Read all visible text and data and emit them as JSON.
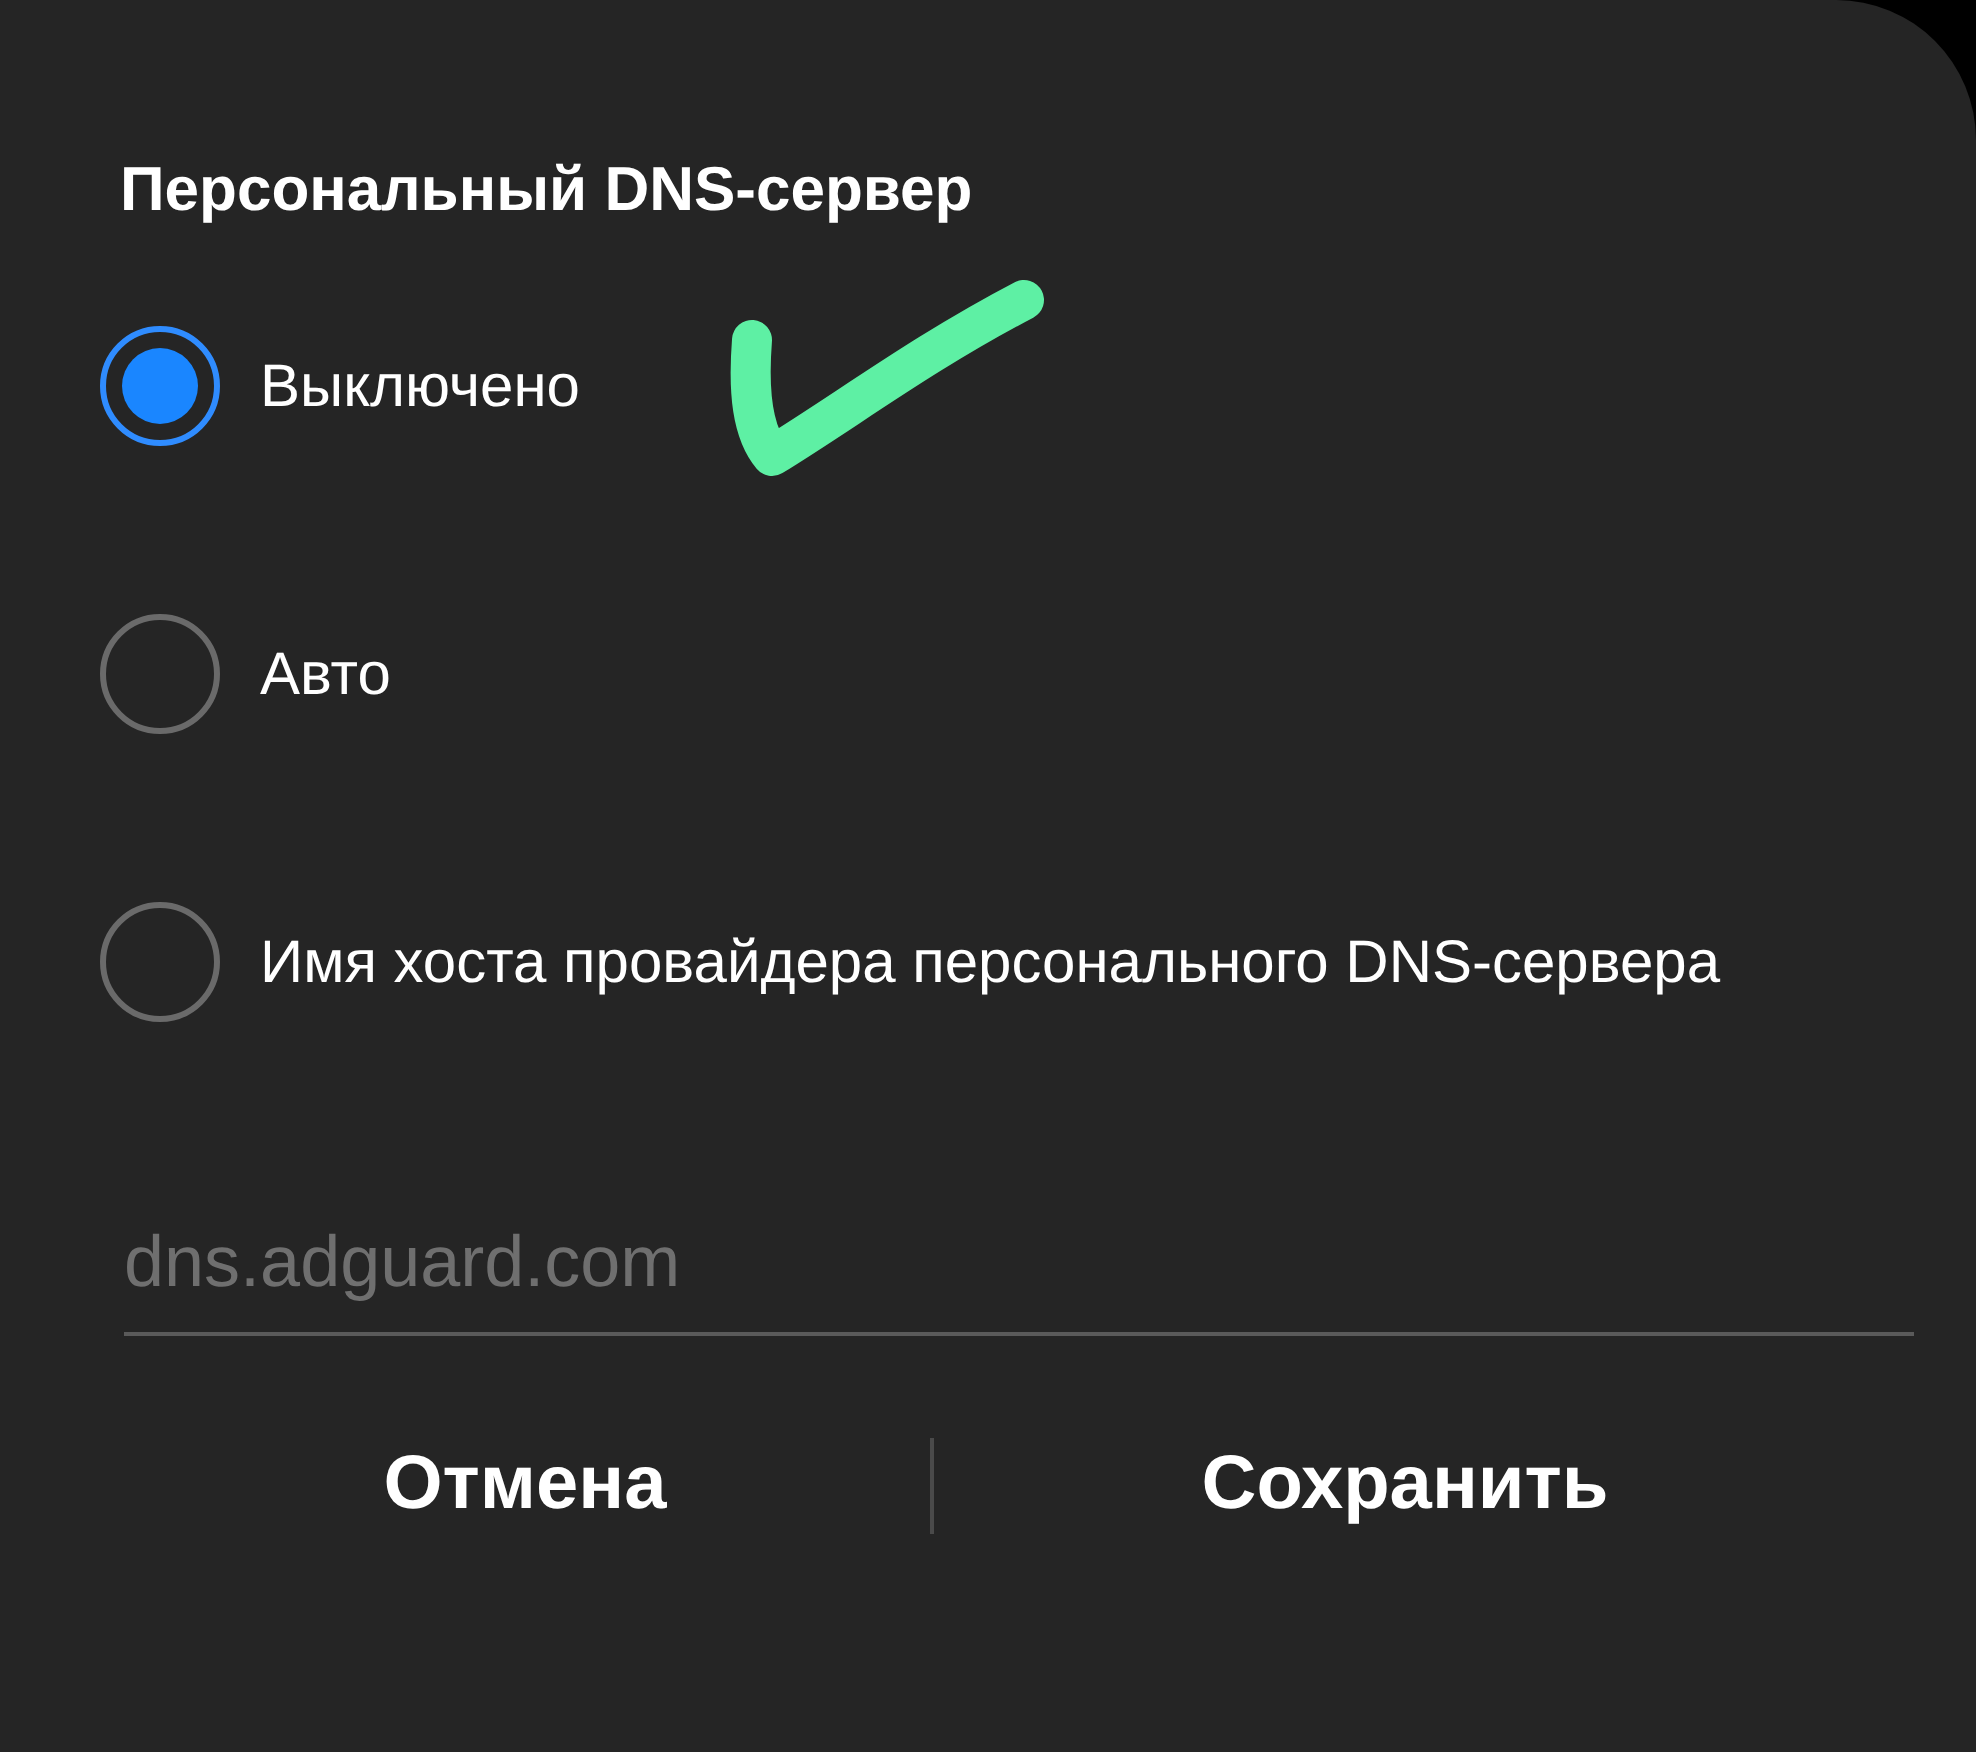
{
  "dialog": {
    "title": "Персональный DNS-сервер"
  },
  "options": [
    {
      "label": "Выключено",
      "selected": true
    },
    {
      "label": "Авто",
      "selected": false
    },
    {
      "label": "Имя хоста провайдера персонального DNS-сервера",
      "selected": false
    }
  ],
  "hostname_field": {
    "placeholder": "dns.adguard.com"
  },
  "buttons": [
    "Отмена",
    "Сохранить"
  ]
}
